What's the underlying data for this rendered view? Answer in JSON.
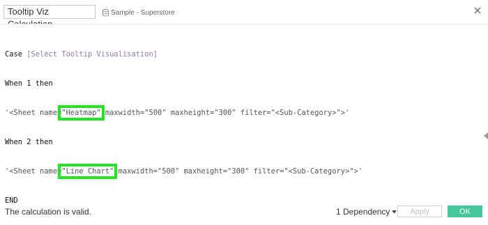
{
  "header": {
    "calc_name": "Tooltip Viz Calculation",
    "datasource_label": "Sample - Superstore",
    "datasource_icon": "database-icon",
    "close_icon": "close-icon"
  },
  "editor": {
    "line1_kw": "Case ",
    "line1_field": "[Select Tooltip Visualisation]",
    "line2": "When 1 then",
    "line3_a": "'<Sheet name=",
    "line3_hl": "\"Heatmap\"",
    "line3_b": " maxwidth=\"500\" maxheight=\"300\" filter=\"<Sub-Category>\">'",
    "line4": "When 2 then",
    "line5_a": "'<Sheet name=",
    "line5_hl": "\"Line Chart\"",
    "line5_b": " maxwidth=\"500\" maxheight=\"300\" filter=\"<Sub-Category>\">'",
    "line6": "END",
    "highlight_color": "#22e622"
  },
  "footer": {
    "status": "The calculation is valid.",
    "dependency_label": "1 Dependency",
    "apply_label": "Apply",
    "ok_label": "OK",
    "ok_color": "#45c79b"
  }
}
